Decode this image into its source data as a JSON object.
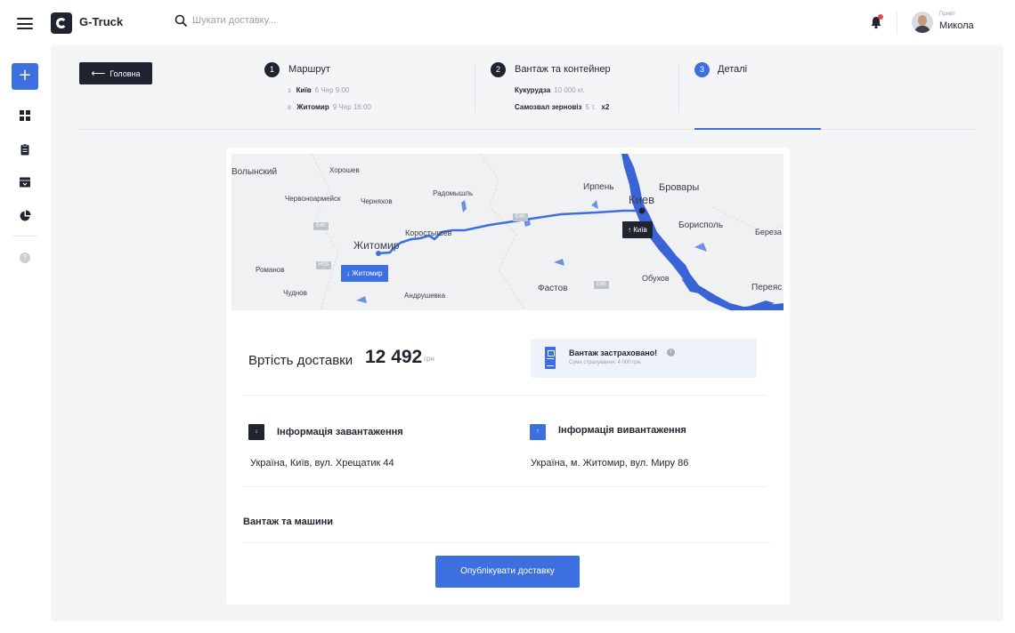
{
  "header": {
    "brand": "G-Truck",
    "search_placeholder": "Шукати доставку...",
    "greeting": "Привіт",
    "user_name": "Микола"
  },
  "nav": {
    "back_label": "Головна"
  },
  "steps": [
    {
      "num": "1",
      "title": "Маршрут",
      "lines": [
        {
          "pre": "з",
          "bold": "Київ",
          "rest": "6 Чер 9:00"
        },
        {
          "pre": "в",
          "bold": "Житомир",
          "rest": "9 Чер 16:00"
        }
      ]
    },
    {
      "num": "2",
      "title": "Вантаж та контейнер",
      "lines": [
        {
          "bold": "Кукурудза",
          "rest": "10 000 кг."
        },
        {
          "bold": "Самозвал зерновіз",
          "rest": "5 т.",
          "extra": "x2"
        }
      ]
    },
    {
      "num": "3",
      "title": "Деталі"
    }
  ],
  "map": {
    "cities": [
      "Волынский",
      "Хорошев",
      "Червоноармейск",
      "Черняхов",
      "Радомышль",
      "Ирпень",
      "Киев",
      "Бровары",
      "Борисполь",
      "Береза",
      "Житомир",
      "Коростышев",
      "Романов",
      "Чуднов",
      "Андрушевка",
      "Фастов",
      "Обухов",
      "Переяс"
    ],
    "roads": [
      "E40",
      "H03",
      "E95",
      "E40"
    ],
    "pin_from": "↑ Київ",
    "pin_to": "↓ Житомир"
  },
  "cost": {
    "label": "Вртість доставки",
    "value": "12 492",
    "unit": "грн"
  },
  "insurance": {
    "title": "Вантаж застраховано!",
    "info": "i",
    "subtitle": "Сума страхування: 4 000 грн."
  },
  "loading": {
    "arrow": "↓",
    "title": "Інформація завантаження",
    "address": "Україна, Київ, вул. Хрещатик 44"
  },
  "unloading": {
    "arrow": "↑",
    "title": "Інформація вивантаження",
    "address": "Україна, м. Житомир, вул. Миру 86"
  },
  "cargo_section": {
    "title": "Вантаж та машини"
  },
  "actions": {
    "publish_label": "Опублікувати доставку"
  },
  "sidebar": {
    "add": "+",
    "help": "?"
  },
  "colors": {
    "accent": "#3d6fe0",
    "dark": "#1f2430",
    "panel_bg": "#f4f5f7",
    "notification": "#e8473f"
  }
}
